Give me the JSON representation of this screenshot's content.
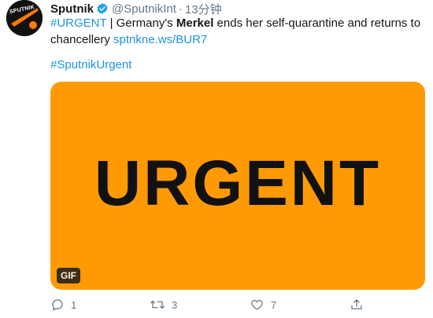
{
  "user": {
    "avatar_text": "SPUTNIK",
    "display_name": "Sputnik",
    "handle": "@SputnikInt",
    "separator": "·",
    "time": "13分钟"
  },
  "tweet": {
    "hashtag_urgent": "#URGENT",
    "text_part1": " | Germany's ",
    "bold_name": "Merkel",
    "text_part2": " ends her self-quarantine and returns to chancellery ",
    "link": "sptnkne.ws/BUR7",
    "hashtag_sputnik": "#SputnikUrgent"
  },
  "media": {
    "text": "URGENT",
    "badge": "GIF",
    "background": "#ff9a05"
  },
  "actions": {
    "reply_count": "1",
    "retweet_count": "3",
    "like_count": "7"
  },
  "colors": {
    "accent": "#1b95e0",
    "verified": "#1da1f2",
    "muted": "#657786"
  }
}
